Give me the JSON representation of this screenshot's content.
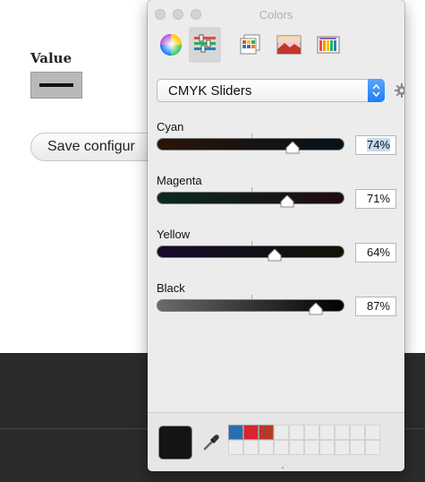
{
  "page": {
    "value_label": "Value",
    "save_button_label": "Save configur"
  },
  "panel": {
    "title": "Colors",
    "toolbar": [
      {
        "name": "color-wheel-icon",
        "active": false
      },
      {
        "name": "color-sliders-icon",
        "active": true
      },
      {
        "name": "color-palettes-icon",
        "active": false
      },
      {
        "name": "image-palettes-icon",
        "active": false
      },
      {
        "name": "crayons-icon",
        "active": false
      }
    ],
    "mode_popup": "CMYK Sliders",
    "sliders": [
      {
        "label": "Cyan",
        "value_text": "74%",
        "value": 0.74,
        "track_from": "#2a1408",
        "track_to": "#05121a",
        "selected": true
      },
      {
        "label": "Magenta",
        "value_text": "71%",
        "value": 0.71,
        "track_from": "#0a2a1c",
        "track_to": "#200a10",
        "selected": false
      },
      {
        "label": "Yellow",
        "value_text": "64%",
        "value": 0.64,
        "track_from": "#150a2a",
        "track_to": "#101406",
        "selected": false
      },
      {
        "label": "Black",
        "value_text": "87%",
        "value": 0.87,
        "track_from": "#6b6b6b",
        "track_to": "#000000",
        "selected": false
      }
    ],
    "current_color": "#141414",
    "swatches": [
      "#2a6db5",
      "#d9232d",
      "#b53a2a"
    ]
  }
}
